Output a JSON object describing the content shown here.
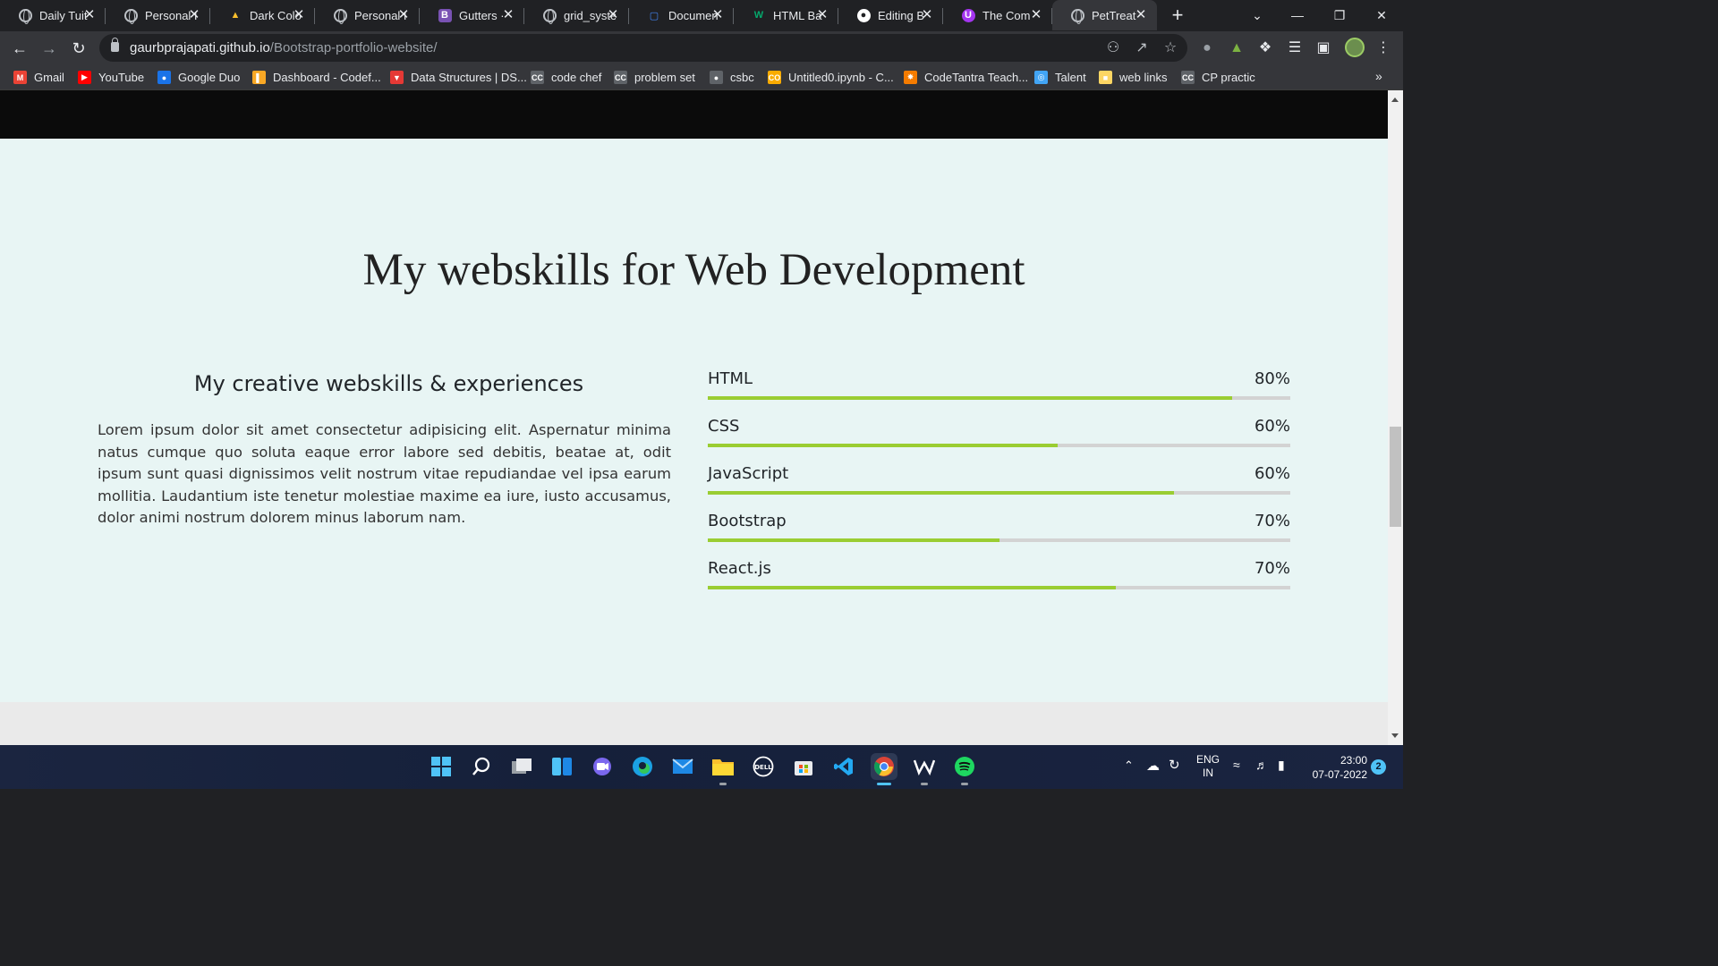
{
  "browser": {
    "tabs": [
      {
        "title": "Daily Tuit",
        "icon": "globe-icon"
      },
      {
        "title": "Personal I",
        "icon": "globe-icon"
      },
      {
        "title": "Dark Colo",
        "icon": "palette-icon"
      },
      {
        "title": "Personal I",
        "icon": "globe-icon"
      },
      {
        "title": "Gutters ·",
        "icon": "bootstrap-icon"
      },
      {
        "title": "grid_syste",
        "icon": "globe-icon"
      },
      {
        "title": "Documen",
        "icon": "docs-icon"
      },
      {
        "title": "HTML Ba",
        "icon": "w3schools-icon"
      },
      {
        "title": "Editing B",
        "icon": "github-icon"
      },
      {
        "title": "The Com",
        "icon": "udemy-icon"
      },
      {
        "title": "PetTreat",
        "icon": "globe-icon"
      }
    ],
    "address": {
      "host": "gaurbprajapati.github.io",
      "path": "/Bootstrap-portfolio-website/"
    },
    "bookmarks": [
      {
        "label": "Gmail",
        "icon": "gmail-icon",
        "color": "#ea4335"
      },
      {
        "label": "YouTube",
        "icon": "youtube-icon",
        "color": "#ff0000"
      },
      {
        "label": "Google Duo",
        "icon": "duo-icon",
        "color": "#1a73e8"
      },
      {
        "label": "Dashboard - Codef...",
        "icon": "codeforces-icon",
        "color": "#f9a825"
      },
      {
        "label": "Data Structures | DS...",
        "icon": "gfg-icon",
        "color": "#e53935"
      },
      {
        "label": "code chef",
        "icon": "codechef-icon",
        "color": "#5f6368"
      },
      {
        "label": "problem set",
        "icon": "codechef-icon",
        "color": "#5f6368"
      },
      {
        "label": "csbc",
        "icon": "globe-icon",
        "color": "#5f6368"
      },
      {
        "label": "Untitled0.ipynb - C...",
        "icon": "colab-icon",
        "color": "#f9ab00"
      },
      {
        "label": "CodeTantra Teach...",
        "icon": "codetantra-icon",
        "color": "#f57c00"
      },
      {
        "label": "Talent",
        "icon": "talent-icon",
        "color": "#42a5f5"
      },
      {
        "label": "web links",
        "icon": "folder-icon",
        "color": "#fdd663"
      },
      {
        "label": "CP practic",
        "icon": "codechef-icon",
        "color": "#5f6368"
      }
    ],
    "more_bookmarks": "»"
  },
  "page": {
    "heading": "My webskills for Web Development",
    "subheading": "My creative webskills & experiences",
    "paragraph": "Lorem ipsum dolor sit amet consectetur adipisicing elit. Aspernatur minima natus cumque quo soluta eaque error labore sed debitis, beatae at, odit ipsum sunt quasi dignissimos velit nostrum vitae repudiandae vel ipsa earum mollitia. Laudantium iste tenetur molestiae maxime ea iure, iusto accusamus, dolor animi nostrum dolorem minus laborum nam.",
    "skills": [
      {
        "name": "HTML",
        "label": "80%",
        "fill": 0.9
      },
      {
        "name": "CSS",
        "label": "60%",
        "fill": 0.6
      },
      {
        "name": "JavaScript",
        "label": "60%",
        "fill": 0.8
      },
      {
        "name": "Bootstrap",
        "label": "70%",
        "fill": 0.5
      },
      {
        "name": "React.js",
        "label": "70%",
        "fill": 0.7
      }
    ],
    "accent_color": "#9acd32"
  },
  "taskbar": {
    "lang": "ENG",
    "region": "IN",
    "time": "23:00",
    "date": "07-07-2022",
    "notifications": "2"
  }
}
